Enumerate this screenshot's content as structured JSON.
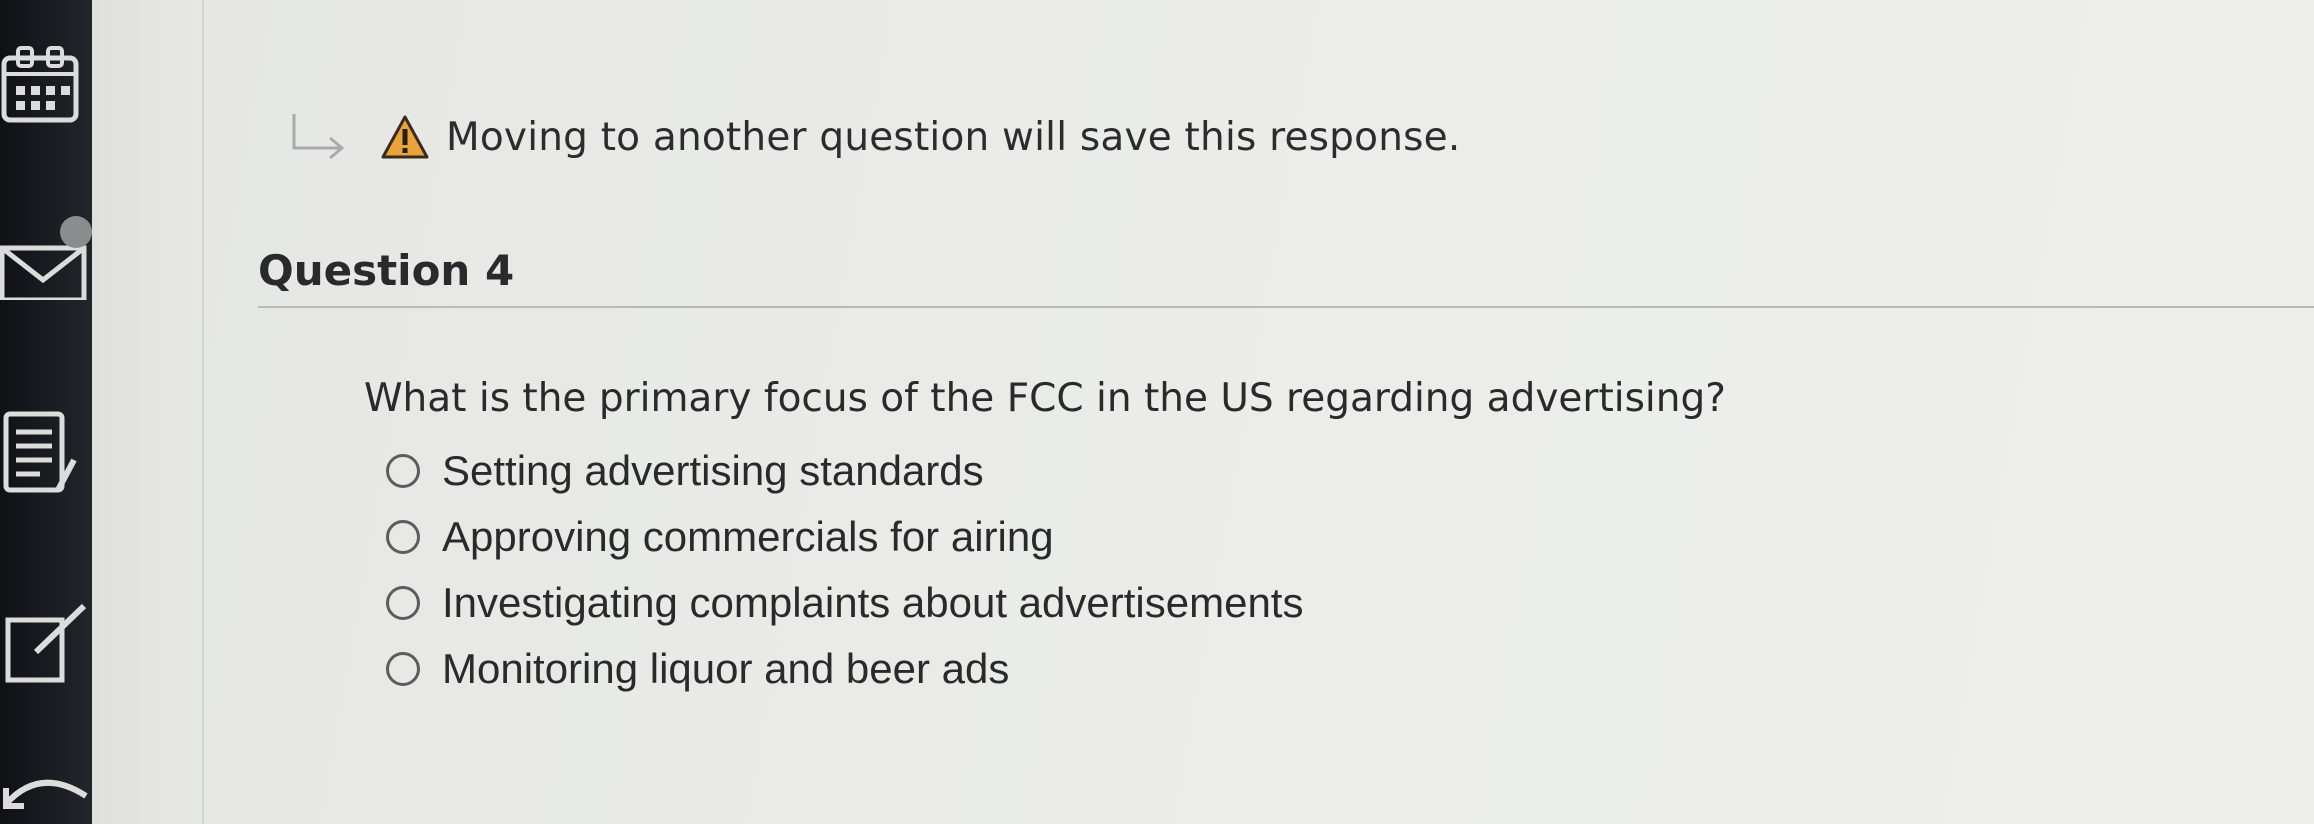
{
  "notice": {
    "text": "Moving to another question will save this response."
  },
  "question": {
    "header": "Question 4",
    "prompt": "What is the primary focus of the FCC in the US regarding advertising?",
    "options": [
      {
        "label": "Setting advertising standards",
        "selected": false
      },
      {
        "label": "Approving commercials for airing",
        "selected": false
      },
      {
        "label": "Investigating complaints about advertisements",
        "selected": false
      },
      {
        "label": "Monitoring liquor and beer ads",
        "selected": false
      }
    ]
  },
  "sidebar": {
    "icons": [
      "calendar-icon",
      "mail-icon",
      "notes-icon",
      "edit-icon",
      "undo-icon"
    ]
  },
  "colors": {
    "rail": "#15181c",
    "page": "#e6e7e4",
    "text": "#2a2a2c",
    "warning": "#e8a33a"
  }
}
